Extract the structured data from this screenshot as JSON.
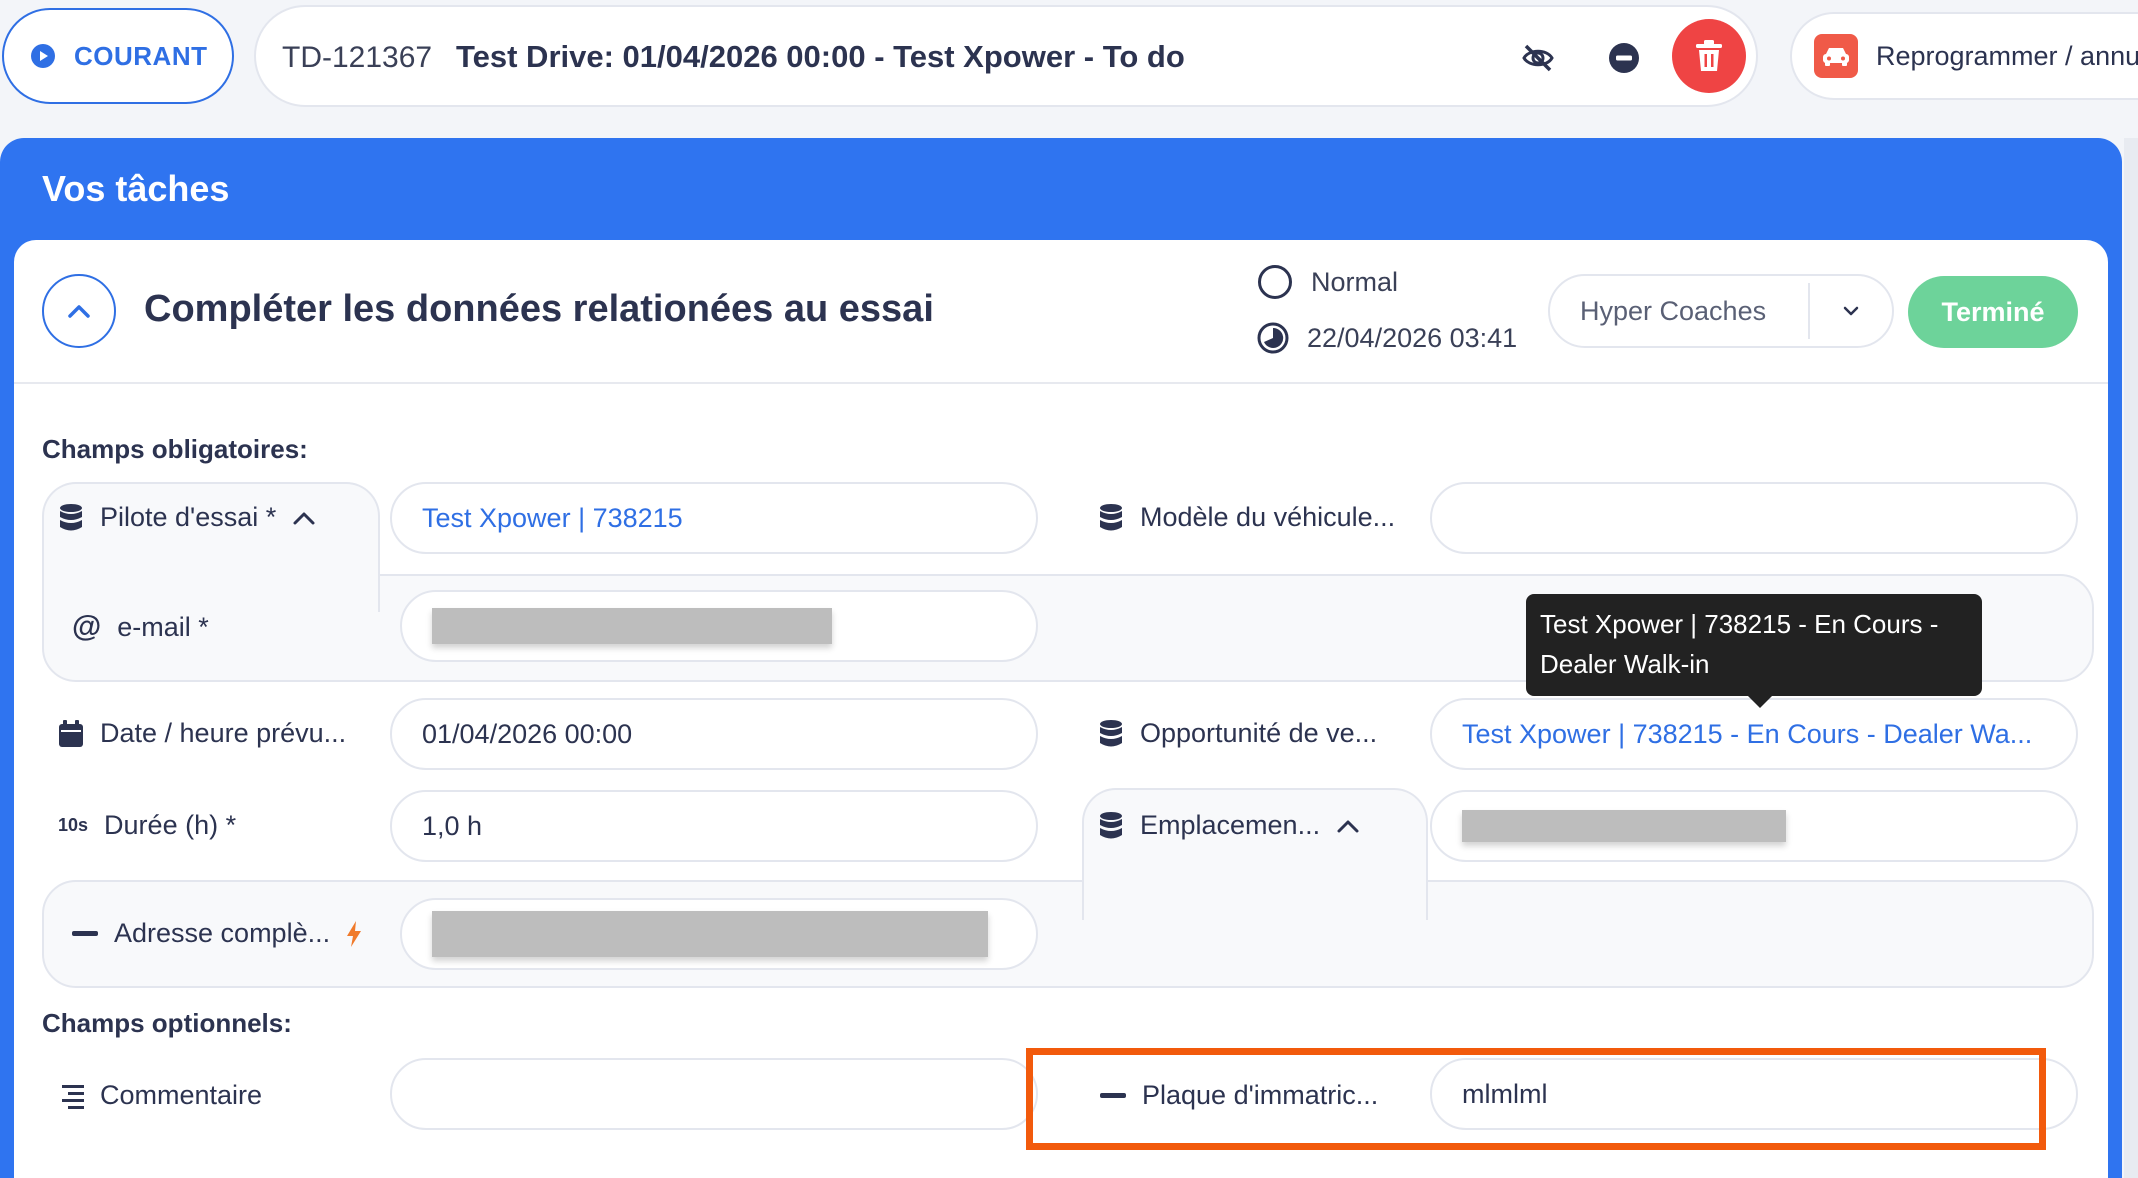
{
  "header": {
    "status_label": "COURANT",
    "record_code": "TD-121367",
    "record_title": "Test Drive: 01/04/2026 00:00 - Test Xpower - To do",
    "reschedule_label": "Reprogrammer / annuler"
  },
  "tasks": {
    "panel_title": "Vos tâches",
    "task_title": "Compléter les données relationées au essai",
    "priority": "Normal",
    "due_date": "22/04/2026 03:41",
    "assignee": "Hyper Coaches",
    "done_label": "Terminé",
    "required_label": "Champs obligatoires:",
    "optional_label": "Champs optionnels:",
    "fields": {
      "pilot": {
        "label": "Pilote d'essai *",
        "value": "Test Xpower | 738215"
      },
      "email": {
        "label": "e-mail *"
      },
      "model": {
        "label": "Modèle du véhicule...",
        "value": ""
      },
      "tooltip": "Test Xpower | 738215 - En Cours - Dealer Walk-in",
      "date": {
        "label": "Date / heure prévu...",
        "value": "01/04/2026 00:00"
      },
      "opportunity": {
        "label": "Opportunité de ve...",
        "value": "Test Xpower | 738215 - En Cours - Dealer Wa..."
      },
      "duration": {
        "label": "Durée (h) *",
        "icon_text": "10s",
        "value": "1,0 h"
      },
      "location": {
        "label": "Emplacemen..."
      },
      "address": {
        "label": "Adresse complè..."
      },
      "comment": {
        "label": "Commentaire",
        "value": ""
      },
      "plate": {
        "label": "Plaque d'immatric...",
        "value": "mlmlml"
      }
    }
  },
  "colors": {
    "accent": "#2f6fe4",
    "panel": "#2f74f0",
    "danger": "#ef4444",
    "success": "#6dd39a",
    "highlight": "#f25a0c"
  }
}
